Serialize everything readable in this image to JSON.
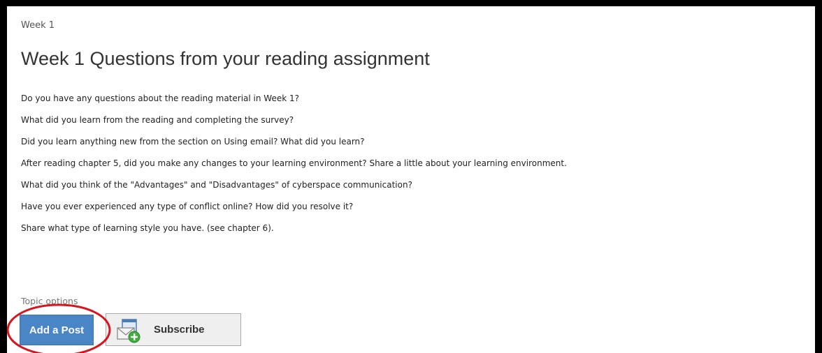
{
  "breadcrumb": "Week 1",
  "topic": {
    "title": "Week 1 Questions from your reading assignment",
    "questions": [
      "Do you have any questions about the reading material in Week 1?",
      "What did you learn from the reading and completing the survey?",
      "Did you learn anything new from the section on Using email?  What did you learn?",
      "After reading chapter 5, did you make any changes to your learning environment?  Share a little about your learning environment.",
      "What did you think of the \"Advantages\" and \"Disadvantages\" of cyberspace communication?",
      "Have you ever experienced any type of conflict online?  How did you resolve it?",
      "Share what type of learning style you have.  (see chapter 6)."
    ]
  },
  "topic_options": {
    "label": "Topic options",
    "add_post_label": "Add a Post",
    "subscribe_label": "Subscribe",
    "subscribe_icon": "mail-plus-icon"
  },
  "colors": {
    "add_post_bg": "#4a86c6",
    "highlight": "#d8141d"
  }
}
